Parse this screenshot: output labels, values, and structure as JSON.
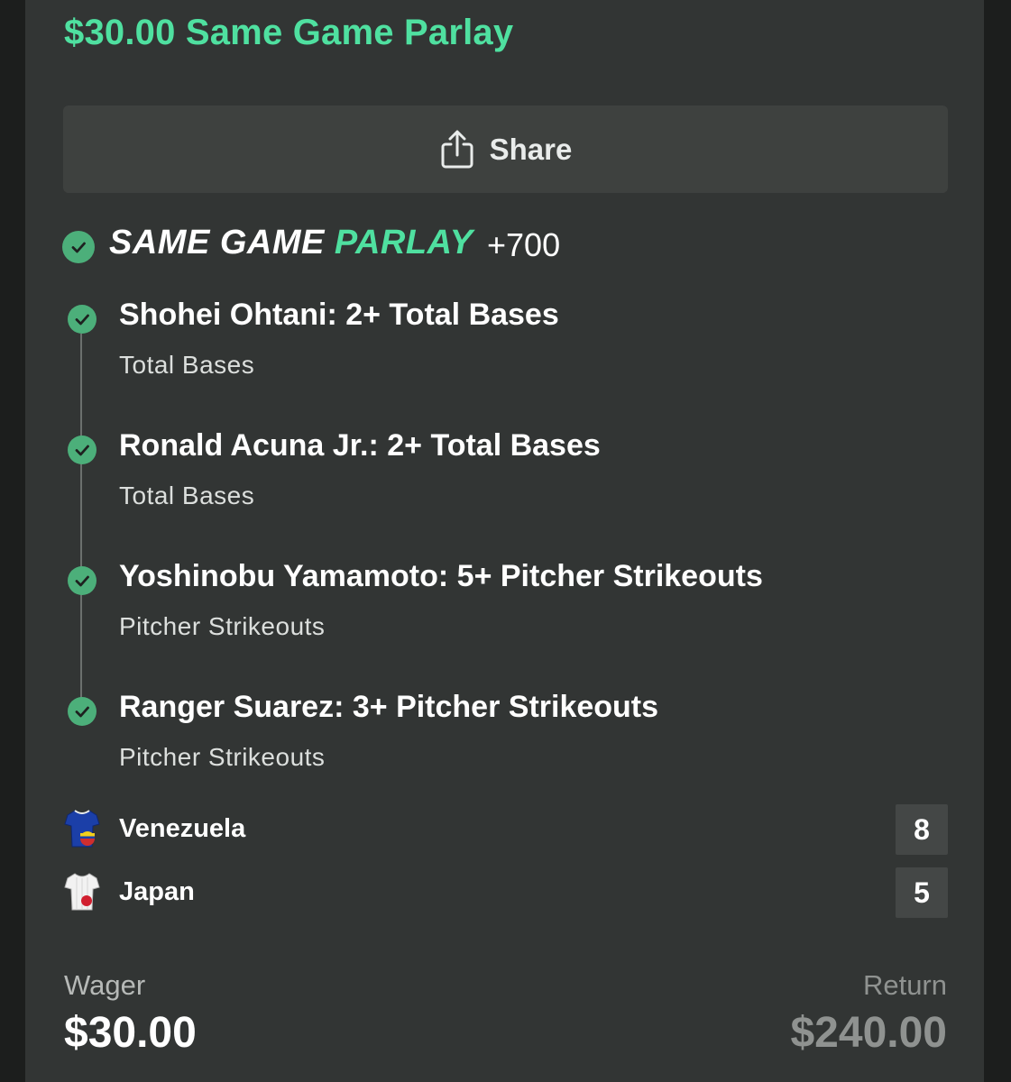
{
  "header": {
    "title": "$30.00 Same Game Parlay"
  },
  "share": {
    "label": "Share",
    "icon": "share-icon"
  },
  "parlay": {
    "title_white": "SAME GAME",
    "title_green": "PARLAY",
    "odds": "+700",
    "status_icon": "check-circle-icon",
    "accent_color": "#4fe0a0",
    "check_color": "#4caf7a"
  },
  "legs": [
    {
      "title": "Shohei Ohtani: 2+ Total Bases",
      "market": "Total Bases"
    },
    {
      "title": "Ronald Acuna Jr.: 2+ Total Bases",
      "market": "Total Bases"
    },
    {
      "title": "Yoshinobu Yamamoto: 5+ Pitcher Strikeouts",
      "market": "Pitcher Strikeouts"
    },
    {
      "title": "Ranger Suarez: 3+ Pitcher Strikeouts",
      "market": "Pitcher Strikeouts"
    }
  ],
  "teams": [
    {
      "name": "Venezuela",
      "score": "8",
      "icon": "venezuela-jersey-icon"
    },
    {
      "name": "Japan",
      "score": "5",
      "icon": "japan-jersey-icon"
    }
  ],
  "wager": {
    "label": "Wager",
    "value": "$30.00"
  },
  "return": {
    "label": "Return",
    "value": "$240.00"
  }
}
